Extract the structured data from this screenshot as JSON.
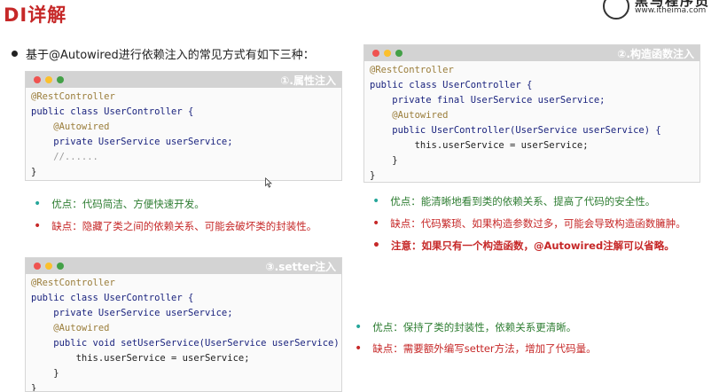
{
  "slide": {
    "title": "DI详解",
    "logo_main": "黑马程序员",
    "logo_url": "www.itheima.com",
    "intro": "基于@Autowired进行依赖注入的常见方式有如下三种："
  },
  "box1": {
    "label": "①.属性注入",
    "lines": [
      "@RestController",
      "public class UserController {",
      "    @Autowired",
      "    private UserService userService;",
      "    //......",
      "}"
    ]
  },
  "box2": {
    "label": "②.构造函数注入",
    "lines": [
      "@RestController",
      "public class UserController {",
      "    private final UserService userService;",
      "    @Autowired",
      "    public UserController(UserService userService) {",
      "        this.userService = userService;",
      "    }",
      "}"
    ]
  },
  "box3": {
    "label": "③.setter注入",
    "lines": [
      "@RestController",
      "public class UserController {",
      "    private UserService userService;",
      "    @Autowired",
      "    public void setUserService(UserService userService) {",
      "        this.userService = userService;",
      "    }",
      "}"
    ]
  },
  "points1": {
    "pro": "优点：代码简洁、方便快速开发。",
    "con": "缺点：隐藏了类之间的依赖关系、可能会破坏类的封装性。"
  },
  "points2": {
    "pro": "优点：能清晰地看到类的依赖关系、提高了代码的安全性。",
    "con": "缺点：代码繁琐、如果构造参数过多，可能会导致构造函数臃肿。",
    "note": "注意：如果只有一个构造函数，@Autowired注解可以省略。"
  },
  "points3": {
    "pro": "优点：保持了类的封装性，依赖关系更清晰。",
    "con": "缺点：需要额外编写setter方法，增加了代码量。"
  },
  "colors": {
    "title": "#c62828",
    "pro": "#2e7d32",
    "con": "#c62828",
    "annotation": "#9a7d3a",
    "keyword": "#1a237e"
  },
  "icons": [
    "mouse-cursor-icon",
    "window-close-icon",
    "window-minimize-icon",
    "window-maximize-icon"
  ]
}
